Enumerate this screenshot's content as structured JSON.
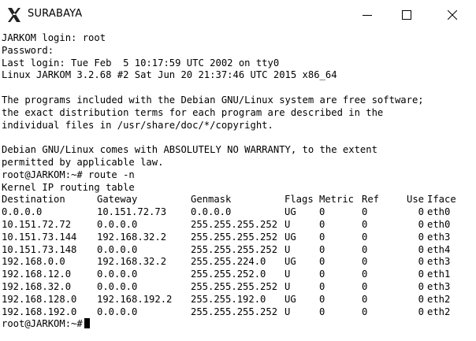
{
  "window": {
    "title": "SURABAYA",
    "icon": "x-window-system-icon",
    "controls": [
      "minimize-icon",
      "maximize-icon",
      "close-icon"
    ]
  },
  "terminal": {
    "login_prompt": "JARKOM login: root",
    "password_prompt": "Password:",
    "last_login": "Last login: Tue Feb  5 10:17:59 UTC 2002 on tty0",
    "uname": "Linux JARKOM 3.2.68 #2 Sat Jun 20 21:37:46 UTC 2015 x86_64",
    "motd": [
      "The programs included with the Debian GNU/Linux system are free software;",
      "the exact distribution terms for each program are described in the",
      "individual files in /usr/share/doc/*/copyright."
    ],
    "warranty": [
      "Debian GNU/Linux comes with ABSOLUTELY NO WARRANTY, to the extent",
      "permitted by applicable law."
    ],
    "command_line": "root@JARKOM:~# route -n",
    "table_title": "Kernel IP routing table",
    "routing_table": {
      "headers": [
        "Destination",
        "Gateway",
        "Genmask",
        "Flags",
        "Metric",
        "Ref",
        "Use",
        "Iface"
      ],
      "rows": [
        [
          "0.0.0.0",
          "10.151.72.73",
          "0.0.0.0",
          "UG",
          "0",
          "0",
          "0",
          "eth0"
        ],
        [
          "10.151.72.72",
          "0.0.0.0",
          "255.255.255.252",
          "U",
          "0",
          "0",
          "0",
          "eth0"
        ],
        [
          "10.151.73.144",
          "192.168.32.2",
          "255.255.255.252",
          "UG",
          "0",
          "0",
          "0",
          "eth3"
        ],
        [
          "10.151.73.148",
          "0.0.0.0",
          "255.255.255.252",
          "U",
          "0",
          "0",
          "0",
          "eth4"
        ],
        [
          "192.168.0.0",
          "192.168.32.2",
          "255.255.224.0",
          "UG",
          "0",
          "0",
          "0",
          "eth3"
        ],
        [
          "192.168.12.0",
          "0.0.0.0",
          "255.255.252.0",
          "U",
          "0",
          "0",
          "0",
          "eth1"
        ],
        [
          "192.168.32.0",
          "0.0.0.0",
          "255.255.255.252",
          "U",
          "0",
          "0",
          "0",
          "eth3"
        ],
        [
          "192.168.128.0",
          "192.168.192.2",
          "255.255.192.0",
          "UG",
          "0",
          "0",
          "0",
          "eth2"
        ],
        [
          "192.168.192.0",
          "0.0.0.0",
          "255.255.255.252",
          "U",
          "0",
          "0",
          "0",
          "eth2"
        ]
      ]
    },
    "final_prompt": "root@JARKOM:~#"
  }
}
